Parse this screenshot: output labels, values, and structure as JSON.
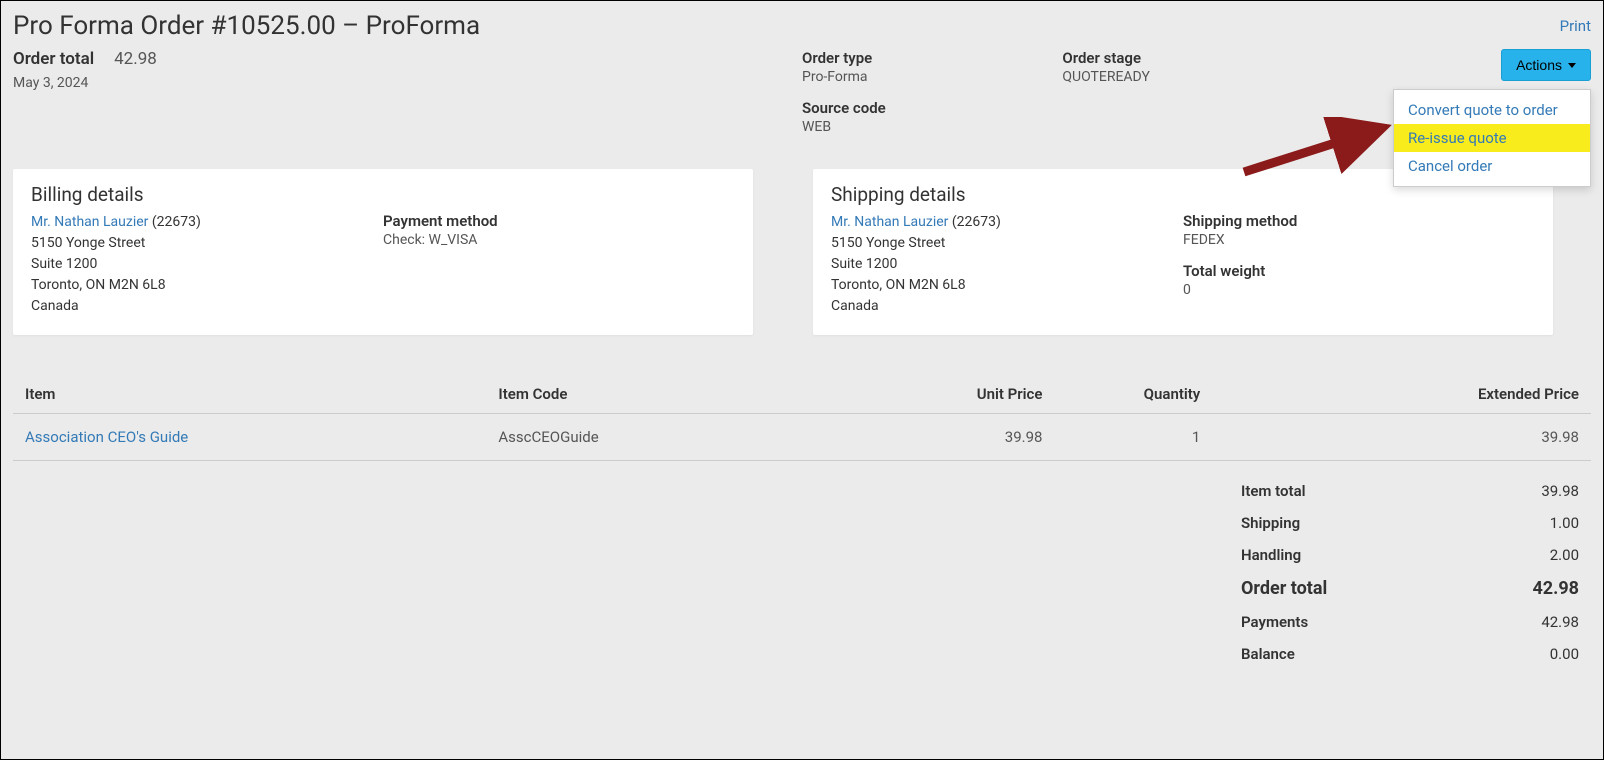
{
  "header": {
    "title": "Pro Forma Order #10525.00 – ProForma",
    "print": "Print"
  },
  "summary": {
    "order_total_label": "Order total",
    "order_total_value": "42.98",
    "date": "May 3, 2024",
    "order_type_label": "Order type",
    "order_type_value": "Pro-Forma",
    "source_code_label": "Source code",
    "source_code_value": "WEB",
    "order_stage_label": "Order stage",
    "order_stage_value": "QUOTEREADY"
  },
  "actions": {
    "button": "Actions",
    "items": {
      "convert": "Convert quote to order",
      "reissue": "Re-issue quote",
      "cancel": "Cancel order"
    }
  },
  "billing": {
    "title": "Billing details",
    "name": "Mr. Nathan Lauzier",
    "id": "(22673)",
    "addr1": "5150 Yonge Street",
    "addr2": "Suite 1200",
    "city": "Toronto, ON M2N 6L8",
    "country": "Canada",
    "payment_method_label": "Payment method",
    "payment_method_value": "Check: W_VISA"
  },
  "shipping": {
    "title": "Shipping details",
    "name": "Mr. Nathan Lauzier",
    "id": "(22673)",
    "addr1": "5150 Yonge Street",
    "addr2": "Suite 1200",
    "city": "Toronto, ON M2N 6L8",
    "country": "Canada",
    "shipping_method_label": "Shipping method",
    "shipping_method_value": "FEDEX",
    "total_weight_label": "Total weight",
    "total_weight_value": "0"
  },
  "table": {
    "headers": {
      "item": "Item",
      "code": "Item Code",
      "unit_price": "Unit Price",
      "quantity": "Quantity",
      "extended": "Extended Price"
    },
    "rows": [
      {
        "item": "Association CEO's Guide",
        "code": "AsscCEOGuide",
        "unit_price": "39.98",
        "quantity": "1",
        "extended": "39.98"
      }
    ]
  },
  "totals": {
    "item_total_label": "Item total",
    "item_total_value": "39.98",
    "shipping_label": "Shipping",
    "shipping_value": "1.00",
    "handling_label": "Handling",
    "handling_value": "2.00",
    "order_total_label": "Order total",
    "order_total_value": "42.98",
    "payments_label": "Payments",
    "payments_value": "42.98",
    "balance_label": "Balance",
    "balance_value": "0.00"
  }
}
